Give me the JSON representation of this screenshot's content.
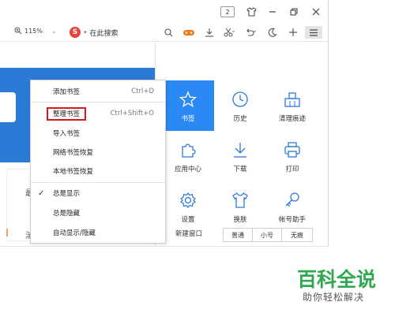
{
  "titlebar": {
    "tab_count": "2",
    "icons": [
      "shirt-icon",
      "minimize-icon",
      "restore-icon",
      "close-icon"
    ]
  },
  "toolbar": {
    "zoom": "115%",
    "search_placeholder": "在此搜索",
    "tools": [
      "search-icon",
      "game-icon",
      "download-icon",
      "scissors-icon",
      "undo-icon",
      "moon-icon",
      "new-tab-icon",
      "menu-icon"
    ]
  },
  "bookmark_menu": {
    "items": [
      {
        "label": "添加书签",
        "shortcut": "Ctrl+D"
      },
      {
        "label": "整理书签",
        "shortcut": "Ctrl+Shift+O"
      },
      {
        "label": "导入书签",
        "shortcut": ""
      },
      {
        "label": "网络书签恢复",
        "shortcut": ""
      },
      {
        "label": "本地书签恢复",
        "shortcut": ""
      },
      {
        "label": "总是显示",
        "checked": true
      },
      {
        "label": "总是隐藏"
      },
      {
        "label": "自动显示/隐藏"
      }
    ]
  },
  "panel": {
    "cells": [
      {
        "label": "书签",
        "icon": "star-icon",
        "active": true
      },
      {
        "label": "历史",
        "icon": "clock-icon"
      },
      {
        "label": "清理痕迹",
        "icon": "broom-icon"
      },
      {
        "label": "应用中心",
        "icon": "puzzle-icon"
      },
      {
        "label": "下载",
        "icon": "download-icon"
      },
      {
        "label": "打印",
        "icon": "printer-icon"
      },
      {
        "label": "设置",
        "icon": "gear-icon"
      },
      {
        "label": "换肤",
        "icon": "shirt-icon"
      },
      {
        "label": "帐号助手",
        "icon": "key-icon"
      }
    ],
    "new_window_label": "新建窗口",
    "window_buttons": [
      "普通",
      "小号",
      "无痕"
    ]
  },
  "page_fragments": {
    "char_1": "最",
    "char_2": "湍"
  },
  "watermark": {
    "title": "百科全说",
    "subtitle": "助你轻松解决"
  },
  "colors": {
    "accent_blue": "#2b7ad6",
    "active_cell": "#2b89f5",
    "highlight_red": "#d7191b",
    "brand_green": "#2fa84f"
  }
}
